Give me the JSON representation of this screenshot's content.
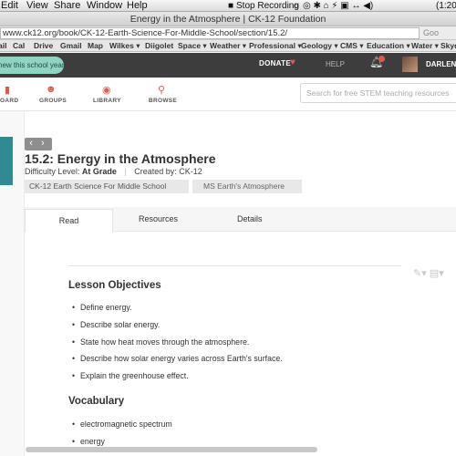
{
  "menubar": {
    "items": [
      "Edit",
      "View",
      "Share",
      "Window",
      "Help"
    ],
    "status": "Stop Recording",
    "clock": "(1:20"
  },
  "window_title": "Energy in the Atmosphere | CK-12 Foundation",
  "address": {
    "url": "www.ck12.org/book/CK-12-Earth-Science-For-Middle-School/section/15.2/",
    "search_hint": "Goo"
  },
  "bookmarks": [
    "ail",
    "Cal",
    "Drive",
    "Gmail",
    "Map",
    "Wilkes ▾",
    "Diigolet",
    "Space ▾",
    "Weather ▾",
    "Professional ▾",
    "Geology ▾",
    "CMS ▾",
    "Education ▾",
    "Water ▾",
    "Skyd"
  ],
  "header": {
    "banner": "new this school year",
    "donate": "DONATE",
    "help": "HELP",
    "username": "DARLENE"
  },
  "nav": {
    "items": [
      "OARD",
      "GROUPS",
      "LIBRARY",
      "BROWSE"
    ],
    "search_placeholder": "Search for free STEM teaching resources"
  },
  "page": {
    "prevnext": "‹ ›",
    "title": "15.2: Energy in the Atmosphere",
    "difficulty_label": "Difficulty Level:",
    "difficulty_value": "At Grade",
    "created_label": "Created by: CK-12",
    "breadcrumbs": [
      "CK-12 Earth Science For Middle School",
      "MS Earth's Atmosphere"
    ],
    "tabs": [
      "Read",
      "Resources",
      "Details"
    ],
    "sections": [
      {
        "heading": "Lesson Objectives",
        "items": [
          "Define energy.",
          "Describe solar energy.",
          "State how heat moves through the atmosphere.",
          "Describe how solar energy varies across Earth's surface.",
          "Explain the greenhouse effect."
        ]
      },
      {
        "heading": "Vocabulary",
        "items": [
          "electromagnetic spectrum",
          "energy"
        ]
      }
    ]
  }
}
